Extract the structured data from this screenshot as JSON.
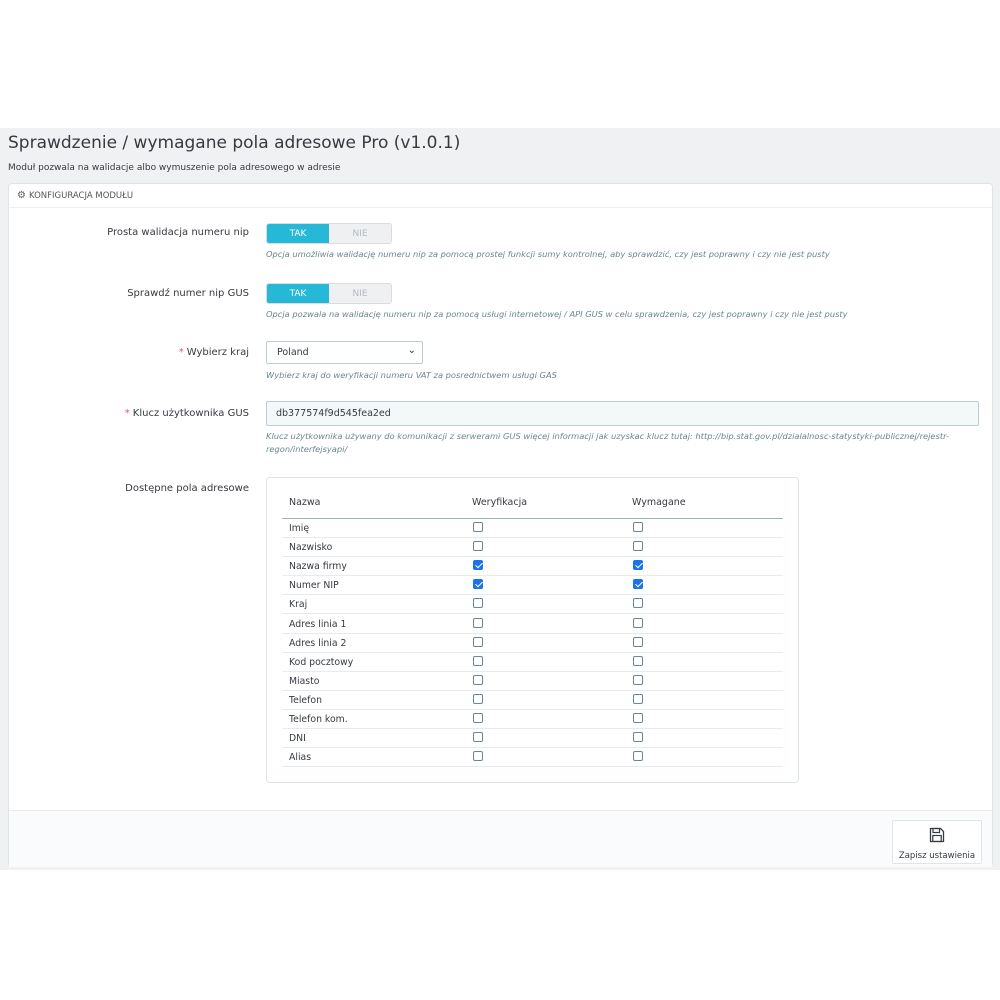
{
  "header": {
    "title": "Sprawdzenie / wymagane pola adresowe Pro (v1.0.1)",
    "subtitle": "Moduł pozwala na walidacje albo wymuszenie pola adresowego w adresie"
  },
  "panel": {
    "heading": "KONFIGURACJA MODUŁU",
    "heading_icon": "gears-icon"
  },
  "form": {
    "nip_validation": {
      "label": "Prosta walidacja numeru nip",
      "yes": "TAK",
      "no": "NIE",
      "value": "TAK",
      "help": "Opcja umożliwia walidację numeru nip za pomocą prostej funkcji sumy kontrolnej, aby sprawdzić, czy jest poprawny i czy nie jest pusty"
    },
    "nip_gus": {
      "label": "Sprawdź numer nip GUS",
      "yes": "TAK",
      "no": "NIE",
      "value": "TAK",
      "help": "Opcja pozwala na walidację numeru nip za pomocą usługi internetowej / API GUS w celu sprawdzenia, czy jest poprawny i czy nie jest pusty"
    },
    "country": {
      "required_mark": "*",
      "label": "Wybierz kraj",
      "value": "Poland",
      "help": "Wybierz kraj do weryfikacji numeru VAT za posrednictwem usługi GAS"
    },
    "gus_key": {
      "required_mark": "*",
      "label": "Klucz użytkownika GUS",
      "value": "db377574f9d545fea2ed",
      "help": "Klucz użytkownika używany do komunikacji z serwerami GUS więcej informacji jak uzyskac klucz tutaj: http://bip.stat.gov.pl/dzialalnosc-statystyki-publicznej/rejestr-regon/interfejsyapi/"
    },
    "address_fields": {
      "label": "Dostępne pola adresowe",
      "columns": [
        "Nazwa",
        "Weryfikacja",
        "Wymagane"
      ],
      "rows": [
        {
          "name": "Imię",
          "verify": false,
          "required": false
        },
        {
          "name": "Nazwisko",
          "verify": false,
          "required": false
        },
        {
          "name": "Nazwa firmy",
          "verify": true,
          "required": true
        },
        {
          "name": "Numer NIP",
          "verify": true,
          "required": true
        },
        {
          "name": "Kraj",
          "verify": false,
          "required": false
        },
        {
          "name": "Adres linia 1",
          "verify": false,
          "required": false
        },
        {
          "name": "Adres linia 2",
          "verify": false,
          "required": false
        },
        {
          "name": "Kod pocztowy",
          "verify": false,
          "required": false
        },
        {
          "name": "Miasto",
          "verify": false,
          "required": false
        },
        {
          "name": "Telefon",
          "verify": false,
          "required": false
        },
        {
          "name": "Telefon kom.",
          "verify": false,
          "required": false
        },
        {
          "name": "DNI",
          "verify": false,
          "required": false
        },
        {
          "name": "Alias",
          "verify": false,
          "required": false
        }
      ]
    }
  },
  "footer": {
    "save_label": "Zapisz ustawienia",
    "save_icon": "floppy-disk-icon"
  },
  "colors": {
    "accent": "#25b9d7",
    "checkbox_checked": "#1a73e8",
    "required": "#e84e6a"
  }
}
